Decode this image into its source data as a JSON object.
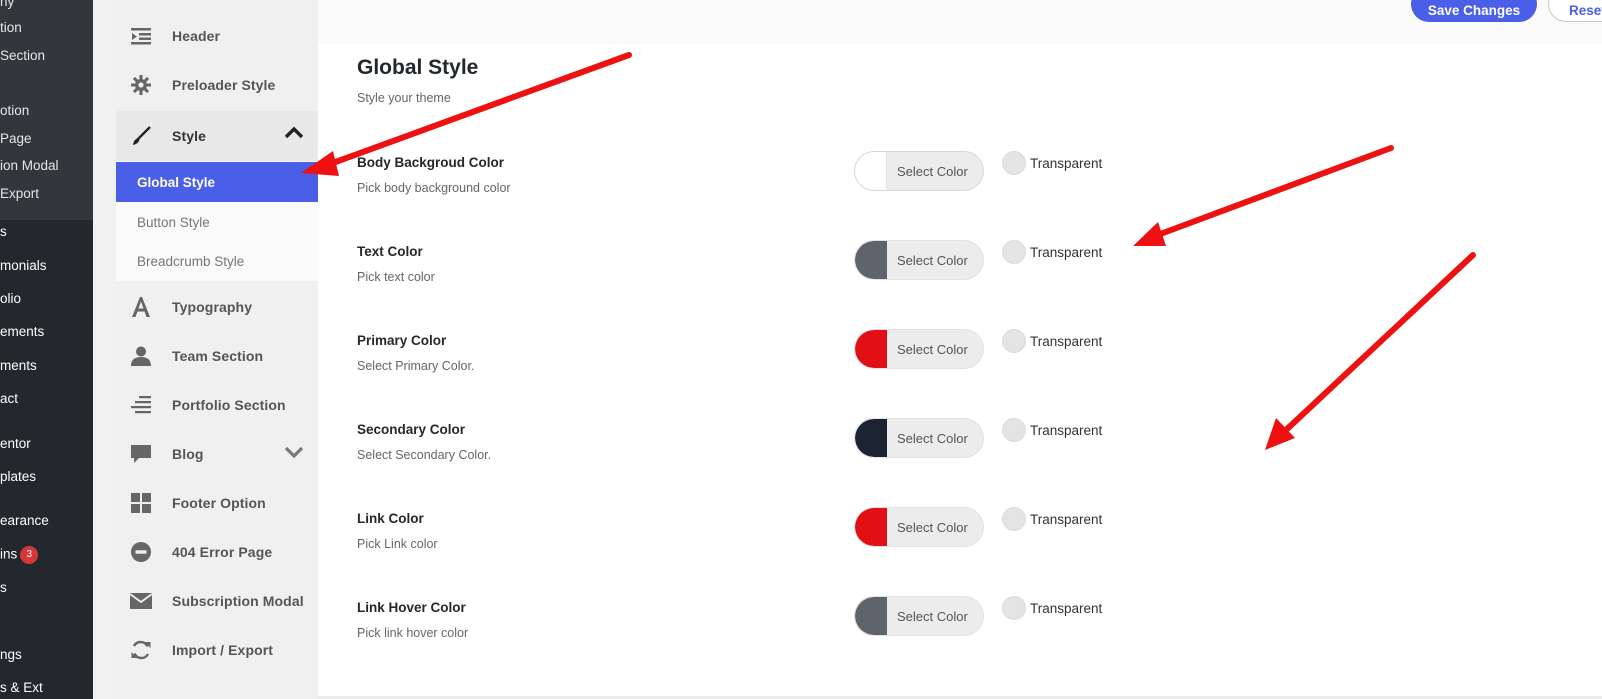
{
  "wp_menu": {
    "submenu": [
      "ny",
      "tion",
      "Section",
      "otion",
      "Page",
      "ion Modal",
      "Export"
    ],
    "items": [
      "s",
      "monials",
      "olio",
      "ements",
      "ments",
      "act",
      "entor",
      "plates",
      "earance",
      "ins",
      "s",
      "",
      "ngs",
      "s & Ext"
    ],
    "plugins_badge": "3"
  },
  "nav": {
    "items": [
      {
        "label": "Header",
        "icon": "header-icon"
      },
      {
        "label": "Preloader Style",
        "icon": "gear-icon"
      },
      {
        "label": "Style",
        "icon": "brush-icon"
      },
      {
        "label": "Typography",
        "icon": "typography-icon"
      },
      {
        "label": "Team Section",
        "icon": "user-icon"
      },
      {
        "label": "Portfolio Section",
        "icon": "align-icon"
      },
      {
        "label": "Blog",
        "icon": "comment-icon"
      },
      {
        "label": "Footer Option",
        "icon": "grid-icon"
      },
      {
        "label": "404 Error Page",
        "icon": "minus-circle-icon"
      },
      {
        "label": "Subscription Modal",
        "icon": "envelope-icon"
      },
      {
        "label": "Import / Export",
        "icon": "refresh-icon"
      }
    ],
    "style_submenu": [
      "Global Style",
      "Button Style",
      "Breadcrumb Style"
    ]
  },
  "toolbar": {
    "save_label": "Save Changes",
    "reset_label": "Reset"
  },
  "section": {
    "title": "Global Style",
    "subtitle": "Style your theme"
  },
  "picker_label": "Select Color",
  "transparent_label": "Transparent",
  "fields": [
    {
      "label": "Body Backgroud Color",
      "desc": "Pick body background color",
      "color": "#ffffff"
    },
    {
      "label": "Text Color",
      "desc": "Pick text color",
      "color": "#5f636b"
    },
    {
      "label": "Primary Color",
      "desc": "Select Primary Color.",
      "color": "#e20f14"
    },
    {
      "label": "Secondary Color",
      "desc": "Select Secondary Color.",
      "color": "#1c2434"
    },
    {
      "label": "Link Color",
      "desc": "Pick Link color",
      "color": "#e20f14"
    },
    {
      "label": "Link Hover Color",
      "desc": "Pick link hover color",
      "color": "#5f636b"
    }
  ],
  "colors": {
    "accent": "#4a5ee8",
    "annotation_arrow": "#ee1111"
  }
}
